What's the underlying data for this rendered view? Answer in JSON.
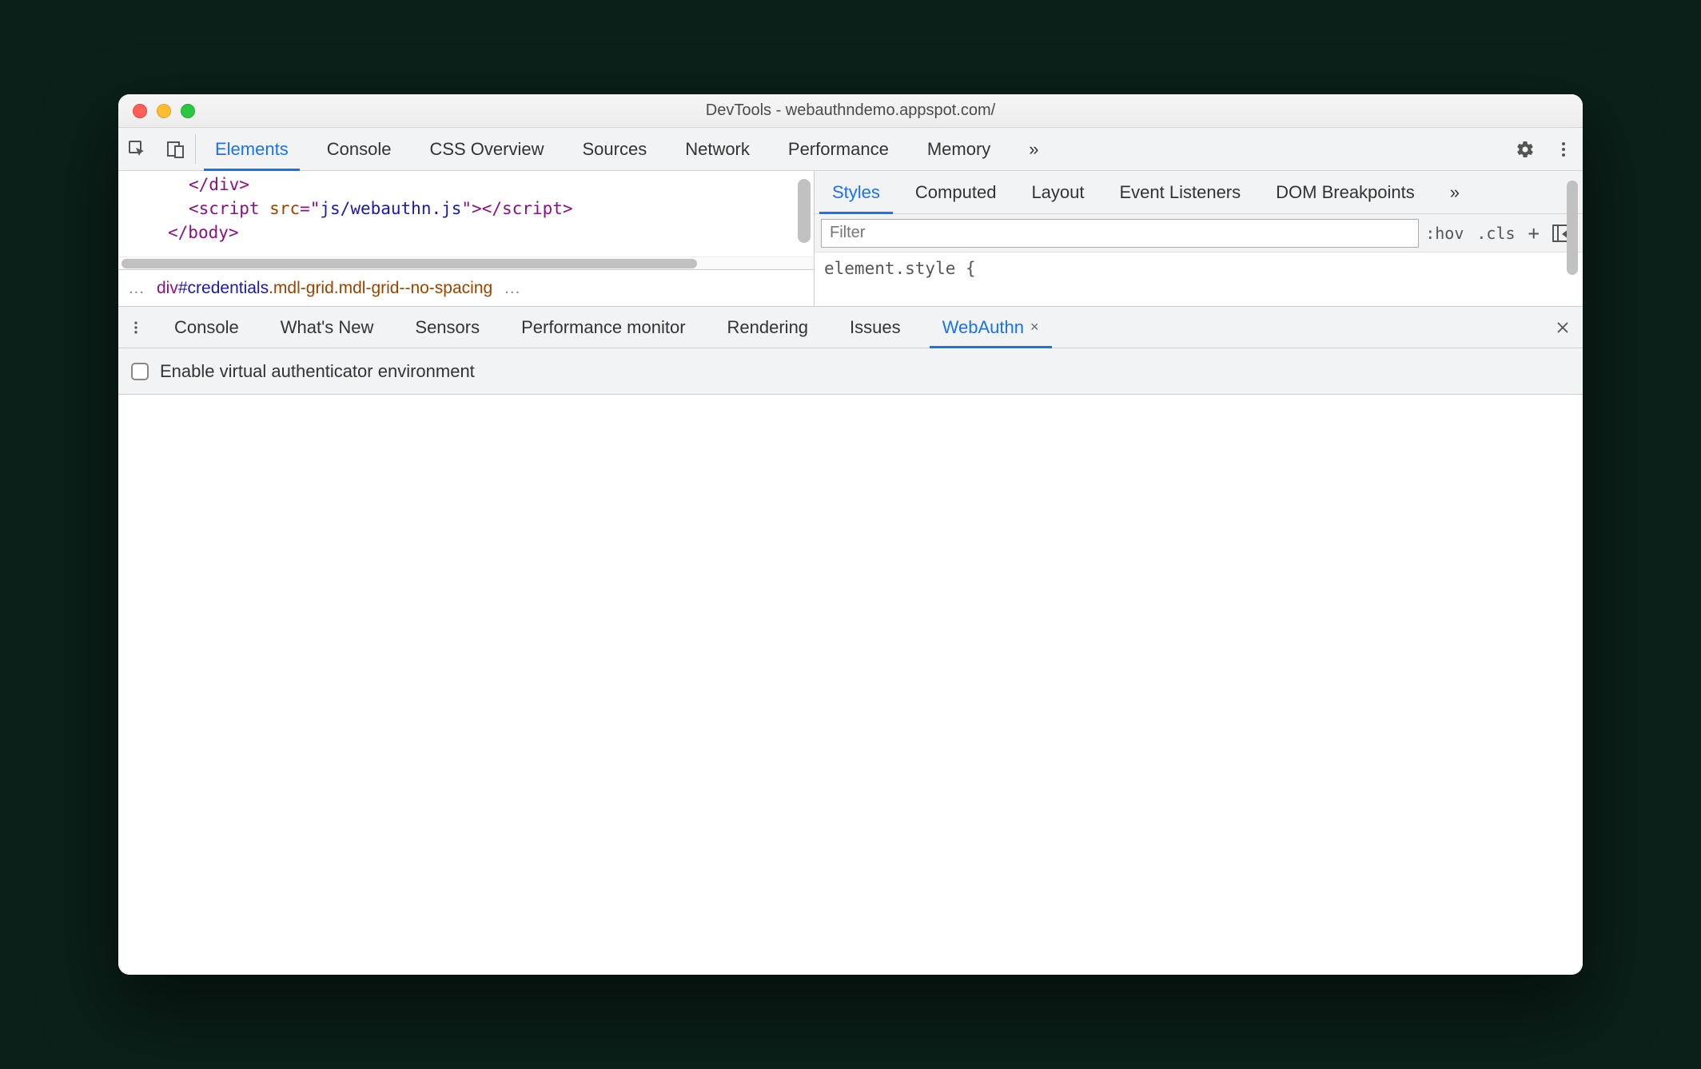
{
  "titlebar": {
    "title": "DevTools - webauthndemo.appspot.com/"
  },
  "mainTabs": {
    "items": [
      "Elements",
      "Console",
      "CSS Overview",
      "Sources",
      "Network",
      "Performance",
      "Memory"
    ],
    "active": "Elements",
    "more": "»"
  },
  "dom": {
    "line1a": "</",
    "line1b": "div",
    "line1c": ">",
    "line2a": "<",
    "line2b": "script",
    "line2c": " src",
    "line2d": "=\"",
    "line2e": "js/webauthn.js",
    "line2f": "\">",
    "line2g": "</",
    "line2h": "script",
    "line2i": ">",
    "line3a": "</",
    "line3b": "body",
    "line3c": ">"
  },
  "breadcrumb": {
    "ellipsisL": "…",
    "tag": "div",
    "id": "#credentials",
    "cls": ".mdl-grid.mdl-grid--no-spacing",
    "ellipsisR": "…"
  },
  "stylesTabs": {
    "items": [
      "Styles",
      "Computed",
      "Layout",
      "Event Listeners",
      "DOM Breakpoints"
    ],
    "active": "Styles",
    "more": "»"
  },
  "stylesFilter": {
    "placeholder": "Filter",
    "hov": ":hov",
    "cls": ".cls",
    "plus": "+"
  },
  "stylesBody": {
    "line1": "element.style {"
  },
  "drawerTabs": {
    "items": [
      "Console",
      "What's New",
      "Sensors",
      "Performance monitor",
      "Rendering",
      "Issues",
      "WebAuthn"
    ],
    "active": "WebAuthn",
    "closeX": "×"
  },
  "webauthn": {
    "checkboxLabel": "Enable virtual authenticator environment"
  }
}
